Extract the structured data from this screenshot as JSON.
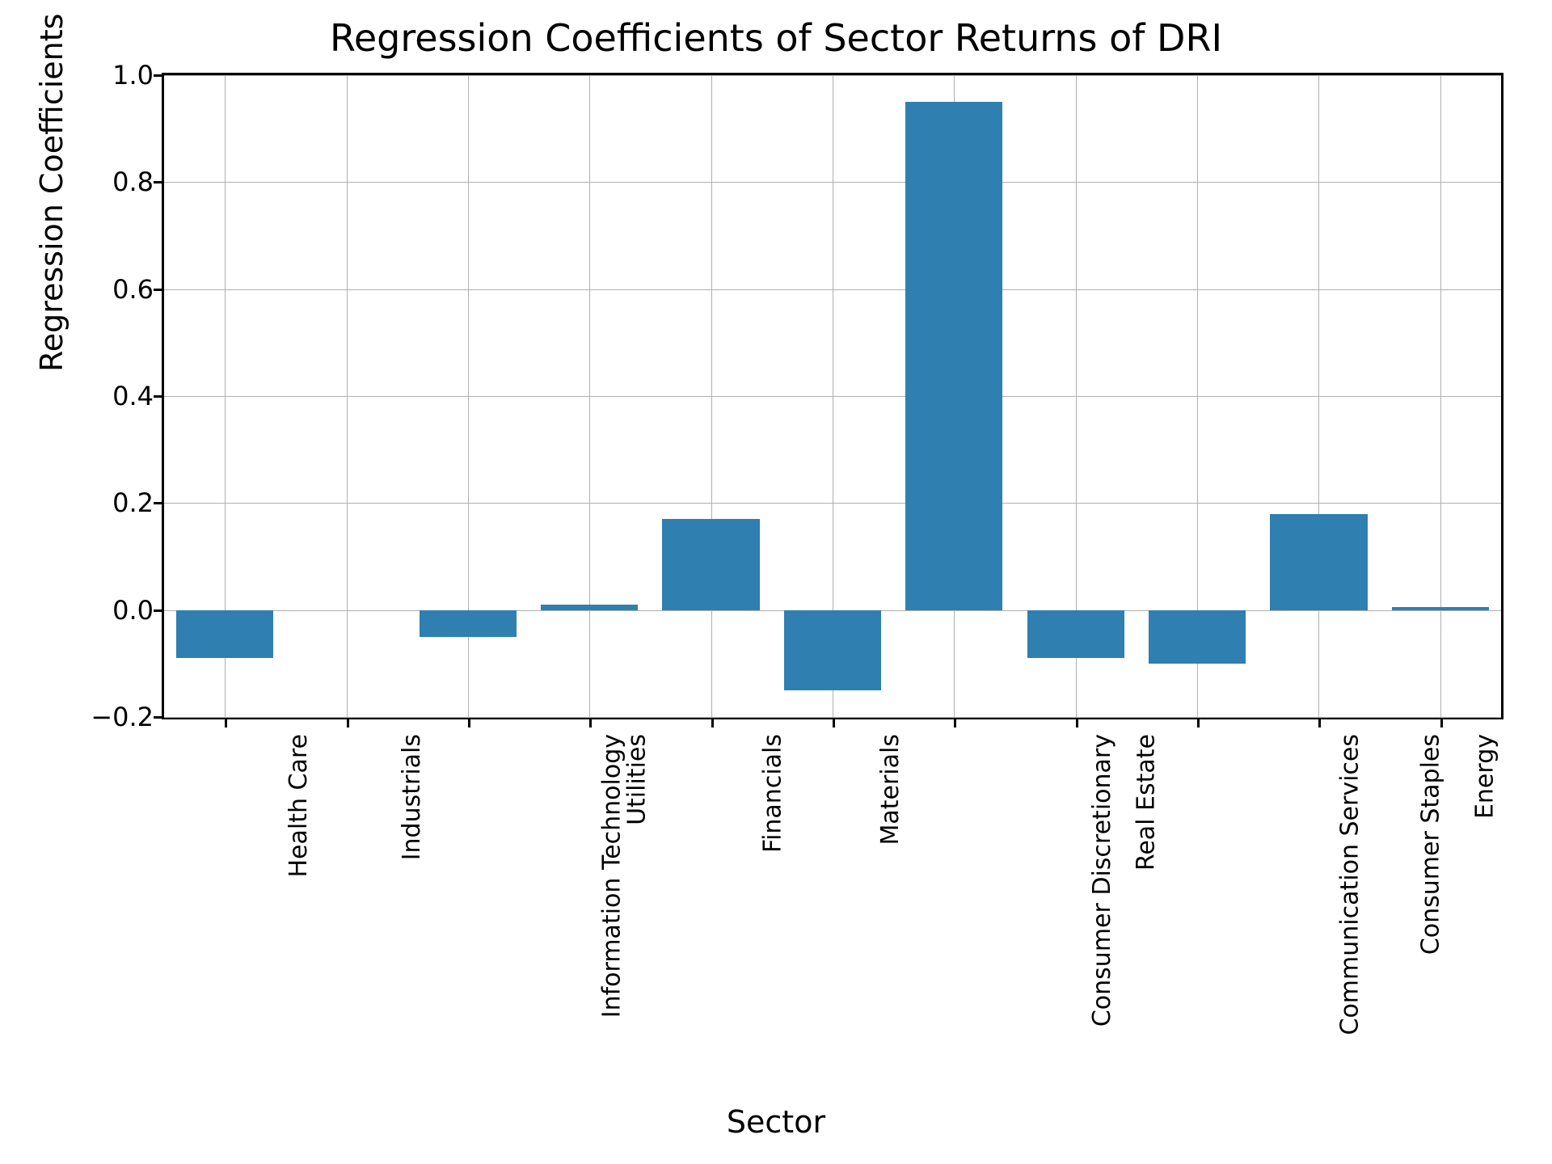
{
  "chart_data": {
    "type": "bar",
    "title": "Regression Coefficients of Sector Returns of DRI",
    "xlabel": "Sector",
    "ylabel": "Regression Coefficients",
    "ylim": [
      -0.2,
      1.0
    ],
    "yticks": [
      -0.2,
      0.0,
      0.2,
      0.4,
      0.6,
      0.8,
      1.0
    ],
    "ytick_labels": [
      "−0.2",
      "0.0",
      "0.2",
      "0.4",
      "0.6",
      "0.8",
      "1.0"
    ],
    "categories": [
      "Health Care",
      "Industrials",
      "Information Technology",
      "Utilities",
      "Financials",
      "Materials",
      "Consumer Discretionary",
      "Real Estate",
      "Communication Services",
      "Consumer Staples",
      "Energy"
    ],
    "values": [
      -0.09,
      0.0,
      -0.05,
      0.01,
      0.17,
      -0.15,
      0.95,
      -0.09,
      -0.1,
      0.18,
      0.005
    ],
    "bar_color": "#2f7fb0",
    "grid": true
  }
}
